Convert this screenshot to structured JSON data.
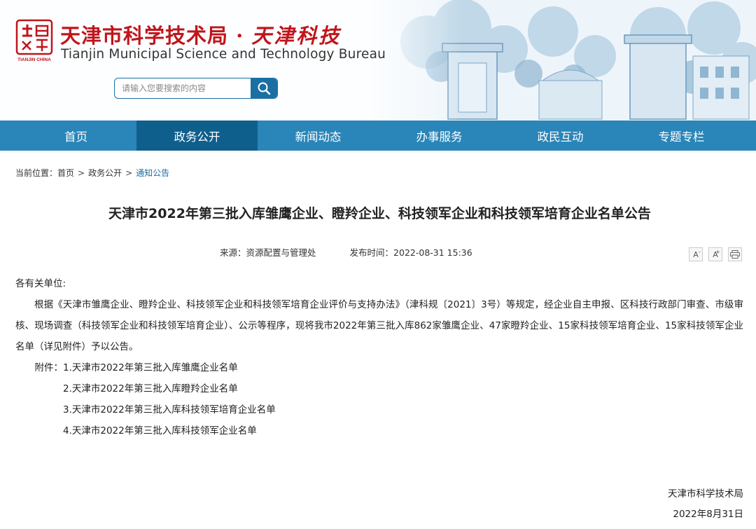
{
  "header": {
    "logo_top": "天津",
    "logo_bottom": "TIANJIN CHINA",
    "title_cn_main": "天津市科学技术局 · ",
    "title_cn_script": "天津科技",
    "title_en": "Tianjin Municipal Science and Technology Bureau",
    "search_placeholder": "请输入您要搜索的内容",
    "brand_red": "#c0151b",
    "accent_blue": "#1b6fa2"
  },
  "nav": {
    "items": [
      "首页",
      "政务公开",
      "新闻动态",
      "办事服务",
      "政民互动",
      "专题专栏"
    ],
    "active_index": 1,
    "bg": "#2a85b8",
    "active_bg": "#0f5f8d"
  },
  "breadcrumb": {
    "prefix": "当前位置：",
    "items": [
      "首页",
      "政务公开",
      "通知公告"
    ],
    "separator": ">"
  },
  "article": {
    "title": "天津市2022年第三批入库雏鹰企业、瞪羚企业、科技领军企业和科技领军培育企业名单公告",
    "source_label": "来源：",
    "source": "资源配置与管理处",
    "published_label": "发布时间：",
    "published": "2022-08-31 15:36",
    "tools": {
      "font_smaller": "A",
      "font_larger": "A",
      "print": "print-icon"
    },
    "salutation": "各有关单位:",
    "paragraph": "根据《天津市雏鹰企业、瞪羚企业、科技领军企业和科技领军培育企业评价与支持办法》（津科规〔2021〕3号）等规定，经企业自主申报、区科技行政部门审查、市级审核、现场调查（科技领军企业和科技领军培育企业）、公示等程序，现将我市2022年第三批入库862家雏鹰企业、47家瞪羚企业、15家科技领军培育企业、15家科技领军企业名单（详见附件）予以公告。",
    "attachments_label": "附件：",
    "attachments": [
      "1.天津市2022年第三批入库雏鹰企业名单",
      "2.天津市2022年第三批入库瞪羚企业名单",
      "3.天津市2022年第三批入库科技领军培育企业名单",
      "4.天津市2022年第三批入库科技领军企业名单"
    ],
    "signature": "天津市科学技术局",
    "date": "2022年8月31日"
  }
}
